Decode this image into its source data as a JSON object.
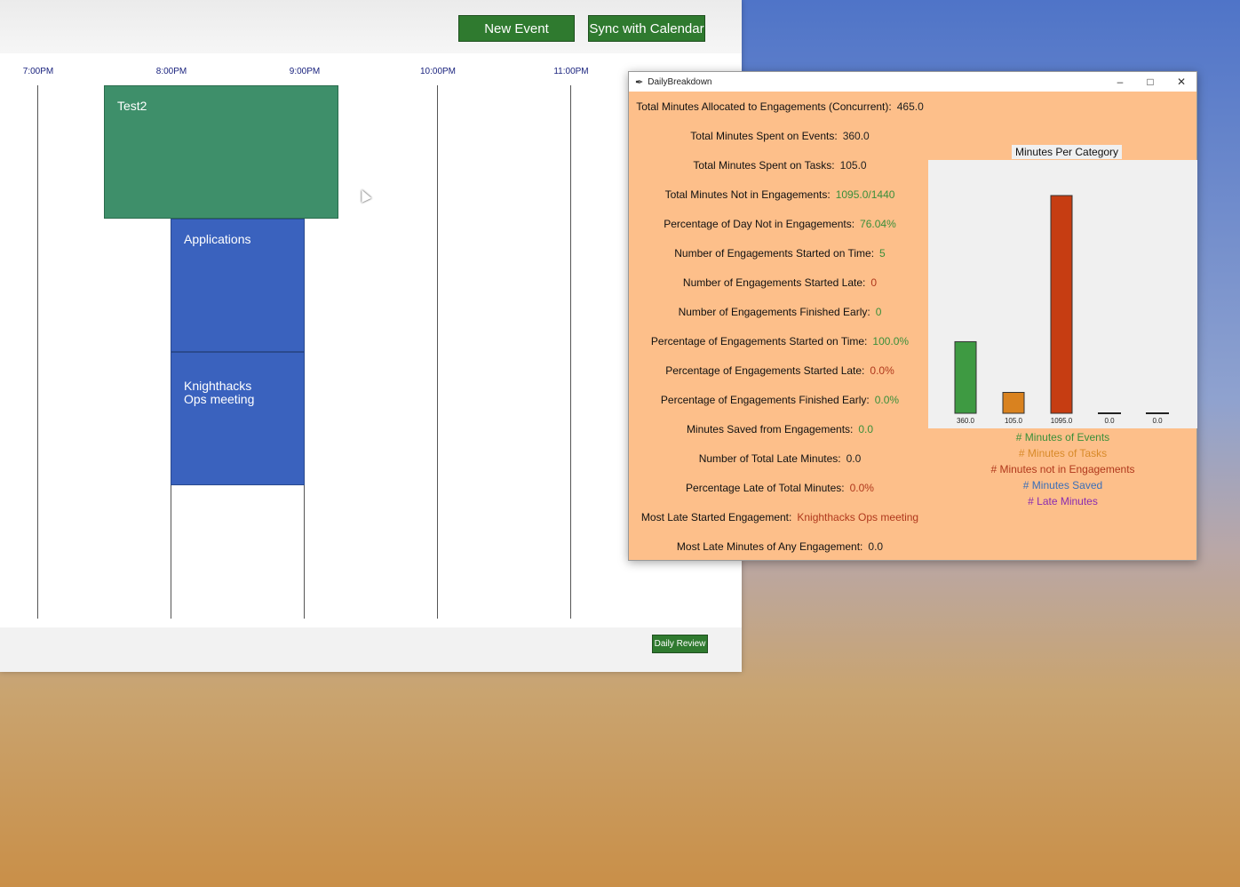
{
  "main": {
    "new_event_label": "New Event",
    "sync_label": "Sync with Calendar",
    "daily_review_label": "Daily Review",
    "time_labels": [
      "7:00PM",
      "8:00PM",
      "9:00PM",
      "10:00PM",
      "11:00PM"
    ],
    "events": [
      {
        "title": "Test2",
        "color": "#3e8f6a"
      },
      {
        "title": "Applications",
        "color": "#3a62be"
      },
      {
        "title": "Knighthacks\nOps meeting",
        "color": "#3a62be"
      }
    ]
  },
  "breakdown": {
    "window_title": "DailyBreakdown",
    "stats": [
      {
        "label": "Total Minutes Allocated to Engagements (Concurrent):",
        "value": "465.0",
        "color": "dark"
      },
      {
        "label": "Total Minutes Spent on Events:",
        "value": "360.0",
        "color": "dark"
      },
      {
        "label": "Total Minutes Spent on Tasks:",
        "value": "105.0",
        "color": "dark"
      },
      {
        "label": "Total Minutes Not in Engagements:",
        "value": "1095.0/1440",
        "color": "green"
      },
      {
        "label": "Percentage of Day Not in Engagements:",
        "value": "76.04%",
        "color": "green"
      },
      {
        "label": "Number of Engagements Started on Time:",
        "value": "5",
        "color": "green"
      },
      {
        "label": "Number of Engagements Started Late:",
        "value": "0",
        "color": "red"
      },
      {
        "label": "Number of Engagements Finished Early:",
        "value": "0",
        "color": "green"
      },
      {
        "label": "Percentage of Engagements Started on Time:",
        "value": "100.0%",
        "color": "green"
      },
      {
        "label": "Percentage of Engagements Started Late:",
        "value": "0.0%",
        "color": "red"
      },
      {
        "label": "Percentage of Engagements Finished Early:",
        "value": "0.0%",
        "color": "green"
      },
      {
        "label": "Minutes Saved from Engagements:",
        "value": "0.0",
        "color": "green"
      },
      {
        "label": "Number of Total Late Minutes:",
        "value": "0.0",
        "color": "dark"
      },
      {
        "label": "Percentage Late of Total Minutes:",
        "value": "0.0%",
        "color": "red"
      },
      {
        "label": "Most Late Started Engagement:",
        "value": "Knighthacks Ops meeting",
        "color": "red"
      },
      {
        "label": "Most Late Minutes of Any Engagement:",
        "value": "0.0",
        "color": "dark"
      }
    ],
    "legend": [
      {
        "label": "# Minutes of Events",
        "color": "#3a8f3a"
      },
      {
        "label": "# Minutes of Tasks",
        "color": "#d88a2a"
      },
      {
        "label": "# Minutes not in Engagements",
        "color": "#b0381c"
      },
      {
        "label": "# Minutes Saved",
        "color": "#3b6fb8"
      },
      {
        "label": "# Late Minutes",
        "color": "#8a2bb0"
      }
    ]
  },
  "chart_data": {
    "type": "bar",
    "title": "Minutes Per Category",
    "categories": [
      "360.0",
      "105.0",
      "1095.0",
      "0.0",
      "0.0"
    ],
    "values": [
      360.0,
      105.0,
      1095.0,
      0.0,
      0.0
    ],
    "colors": [
      "#3e9a42",
      "#d9821f",
      "#c63d12",
      "#222222",
      "#222222"
    ],
    "ylim": [
      0,
      1095.0
    ]
  }
}
